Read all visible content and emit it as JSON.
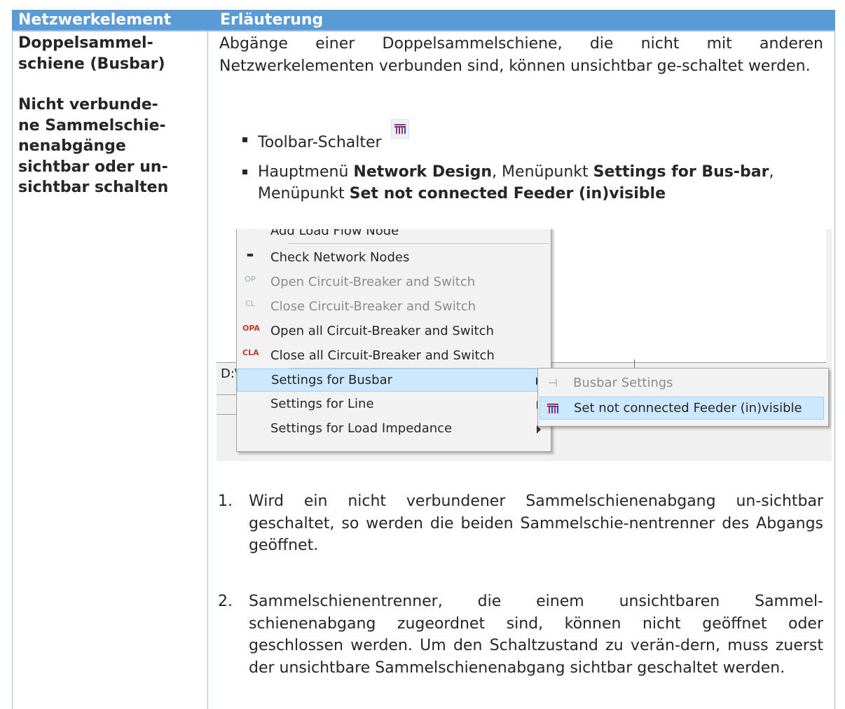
{
  "header": {
    "col1": "Netzwerkelement",
    "col2": "Erläuterung"
  },
  "element": {
    "name_line1": "Doppelsammel-",
    "name_line2": "schiene (Busbar)",
    "func_line1": "Nicht verbunde-",
    "func_line2": "ne Sammelschie-",
    "func_line3": "nenabgänge",
    "func_line4": "sichtbar oder un-",
    "func_line5": "sichtbar schalten"
  },
  "intro": "Abgänge einer Doppelsammelschiene, die nicht mit anderen Netzwerkelementen verbunden sind, können unsichtbar ge-schaltet werden.",
  "bullets": {
    "b1": "Toolbar-Schalter",
    "b2_pre": "Hauptmenü ",
    "b2_bold1": "Network Design",
    "b2_mid": ", Menüpunkt ",
    "b2_bold2": "Settings for Bus-bar",
    "b2_mid2": ", Menüpunkt ",
    "b2_bold3": "Set not connected Feeder (in)visible"
  },
  "screenshot": {
    "menu_items": [
      {
        "label": "Add Load Flow Node",
        "icon": "load-flow-node-icon"
      },
      {
        "label": "Check Network Nodes",
        "icon": "check-nodes-icon"
      },
      {
        "label": "Open Circuit-Breaker and Switch",
        "icon": "op-icon"
      },
      {
        "label": "Close Circuit-Breaker and Switch",
        "icon": "cl-icon"
      },
      {
        "label": "Open all Circuit-Breaker and Switch",
        "icon": "opa-icon"
      },
      {
        "label": "Close all Circuit-Breaker and Switch",
        "icon": "cla-icon"
      },
      {
        "label": "Settings for Busbar",
        "icon": ""
      },
      {
        "label": "Settings for Line",
        "icon": ""
      },
      {
        "label": "Settings for Load Impedance",
        "icon": ""
      }
    ],
    "icon_texts": {
      "op": "OP",
      "cl": "CL",
      "opa": "OPA",
      "cla": "CLA"
    },
    "submenu_items": [
      {
        "label": "Busbar Settings",
        "icon": "busbar-settings-icon"
      },
      {
        "label": "Set not connected Feeder (in)visible",
        "icon": "busbar-icon"
      }
    ],
    "bg_fragment": "D:\\"
  },
  "list": [
    {
      "num": "1.",
      "text": "Wird ein nicht verbundener Sammelschienenabgang un-sichtbar geschaltet, so werden die beiden Sammelschie-nentrenner des Abgangs geöffnet."
    },
    {
      "num": "2.",
      "text": "Sammelschienentrenner, die einem unsichtbaren Sammel-schienenabgang zugeordnet sind, können nicht geöffnet oder geschlossen werden. Um den Schaltzustand zu verän-dern, muss zuerst der unsichtbare Sammelschienenabgang sichtbar geschaltet werden."
    }
  ],
  "colors": {
    "header_bg": "#5b9bd5",
    "grid": "#9cc2e5",
    "highlight": "#cce8ff"
  }
}
